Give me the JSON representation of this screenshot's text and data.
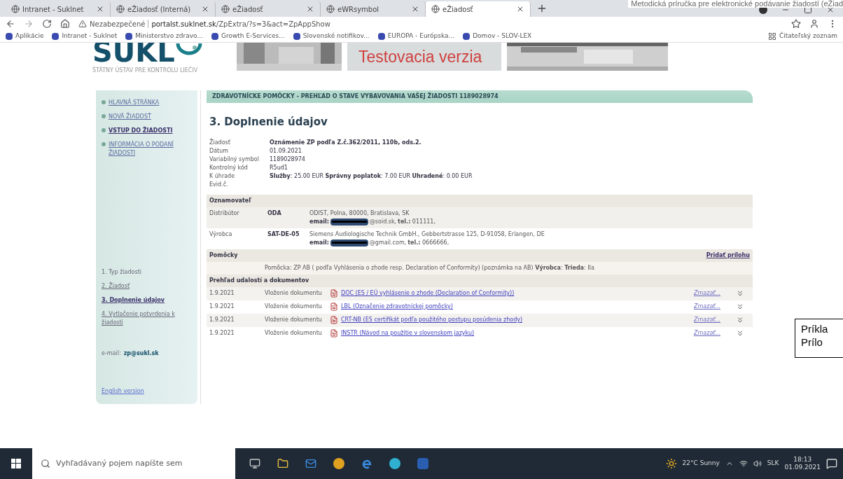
{
  "document_header": "Metodická príručka pre elektronické podávanie žiadostí (eŽiad",
  "tabs": [
    {
      "label": "Intranet - Suklnet",
      "selected": false
    },
    {
      "label": "eŽiadosť (Interná)",
      "selected": false
    },
    {
      "label": "eŽiadosť",
      "selected": false
    },
    {
      "label": "eWRsymbol",
      "selected": false
    },
    {
      "label": "eŽiadosť",
      "selected": true
    }
  ],
  "address_bar": {
    "security": "Nezabezpečené",
    "url_host": "portalst.suklnet.sk",
    "url_path": "/ZpExtra/?s=3&act=ZpAppShow"
  },
  "bookmarks": [
    "Aplikácie",
    "Intranet - Suklnet",
    "Ministerstvo zdravo...",
    "Growth E-Services...",
    "Slovenské notifikov...",
    "EUROPA - Európska...",
    "Domov - SLOV-LEX"
  ],
  "reading_list": "Čitateľský zoznam",
  "logo": {
    "text": "SUKL",
    "tagline": "ŠTÁTNY ÚSTAV PRE KONTROLU LIEČIV"
  },
  "banner": {
    "text": "Testovacia verzia"
  },
  "sidebar": {
    "menu": [
      {
        "label": "HLAVNÁ STRÁNKA",
        "selected": false
      },
      {
        "label": "NOVÁ ŽIADOSŤ",
        "selected": false
      },
      {
        "label": "VSTUP DO ŽIADOSTI",
        "selected": true
      },
      {
        "label": "INFORMÁCIA O PODANÍ ŽIADOSTI",
        "selected": false
      }
    ],
    "steps": [
      {
        "label": "1. Typ žiadosti",
        "kind": "text",
        "selected": false
      },
      {
        "label": "2. Žiadosť",
        "kind": "link",
        "selected": false
      },
      {
        "label": "3. Doplnenie údajov",
        "kind": "link",
        "selected": true
      },
      {
        "label": "4. Vytlačenie potvrdenia k žiadosti",
        "kind": "link",
        "selected": false
      }
    ],
    "email_label": "e-mail:",
    "email": "zp@sukl.sk",
    "english_link": "English version"
  },
  "title_bar": "ZDRAVOTNÍCKE POMÔCKY - PREHĽAD O STAVE VYBAVOVANIA VAŠEJ ŽIADOSTI 1189028974",
  "heading": "3. Doplnenie údajov",
  "details": [
    {
      "label": "Žiadosť",
      "value": "**Oznámenie ZP podľa Z.č.362/2011, 110b, ods.2.**"
    },
    {
      "label": "Dátum",
      "value": "01.09.2021"
    },
    {
      "label": "Variabilný symbol",
      "value": "1189028974"
    },
    {
      "label": "Kontrolný kód",
      "value": "R5ud1"
    },
    {
      "label": "K úhrade",
      "value": "**Služby**: 25.00 EUR **Správny poplatok**: 7.00 EUR **Uhradené**: 0.00 EUR"
    },
    {
      "label": "Evid.č."
    }
  ],
  "notifier": {
    "title": "Oznamovateľ",
    "rows": [
      {
        "role": "Distribútor",
        "code": "ODA",
        "address": "ODIST, Polna, 80000, Bratislava, SK",
        "email_label": "email:",
        "email_rest": "@soid.sk,",
        "tel": "**tel.:** 011111,"
      },
      {
        "role": "Výrobca",
        "code": "SAT-DE-05",
        "address": "Siemens Audiologische Technik GmbH., Gebbertstrasse 125, D-91058, Erlangen, DE",
        "email_label": "email:",
        "email_rest": "@gmail.com,",
        "tel": "**tel.:** 0666666,"
      }
    ]
  },
  "devices": {
    "title": "Pomôcky",
    "add_link": "Pridať prílohu",
    "item": "Pomôcka: ZP AB ( podľa Vyhlásenia o zhode resp. Declaration of Conformity) (poznámka na AB) **Výrobca**: **Trieda**: IIa"
  },
  "events": {
    "title": "Prehľad udalostí a dokumentov",
    "rows": [
      {
        "date": "1.9.2021",
        "action": "Vloženie dokumentu",
        "document": "DOC (ES / EÚ vyhlásenie o zhode (Declaration of Conformity))",
        "delete": "Zmazať..."
      },
      {
        "date": "1.9.2021",
        "action": "Vloženie dokumentu",
        "document": "LBL (Označenie zdravotníckej pomôcky)",
        "delete": "Zmazať..."
      },
      {
        "date": "1.9.2021",
        "action": "Vloženie dokumentu",
        "document": "CRT-NB (ES certifikát podľa použitého postupu posúdenia zhody)",
        "delete": "Zmazať..."
      },
      {
        "date": "1.9.2021",
        "action": "Vloženie dokumentu",
        "document": "INSTR (Návod na použitie v slovenskom jazyku)",
        "delete": "Zmazať..."
      }
    ]
  },
  "callout": [
    "Príkla",
    "Prílo"
  ],
  "taskbar": {
    "search_placeholder": "Vyhľadávaný pojem napíšte sem",
    "weather": "22°C Sunny",
    "language": "SLK",
    "time": "18:13",
    "date": "01.09.2021"
  }
}
